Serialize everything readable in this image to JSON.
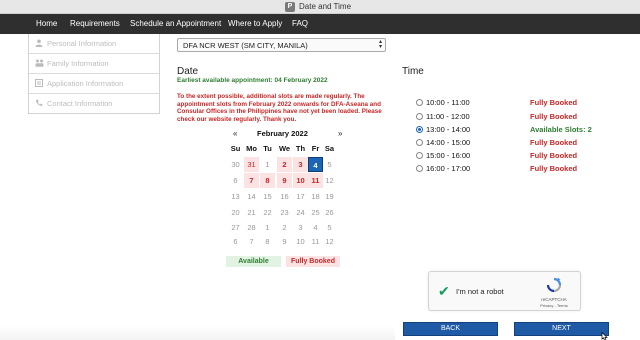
{
  "window": {
    "title": "Date and Time",
    "app_icon_letter": "P"
  },
  "nav": {
    "items": [
      {
        "label": "Home"
      },
      {
        "label": "Requirements"
      },
      {
        "label": "Schedule an Appointment"
      },
      {
        "label": "Where to Apply"
      },
      {
        "label": "FAQ"
      }
    ]
  },
  "sidebar": {
    "items": [
      {
        "label": "Personal Information",
        "icon": "user-icon"
      },
      {
        "label": "Family Information",
        "icon": "family-icon"
      },
      {
        "label": "Application Information",
        "icon": "list-icon"
      },
      {
        "label": "Contact Information",
        "icon": "phone-icon"
      }
    ]
  },
  "site_select": {
    "value": "DFA NCR WEST (SM CITY, MANILA)"
  },
  "date_section": {
    "heading": "Date",
    "earliest": "Earliest available appointment: 04 February 2022",
    "notice": "To the extent possible, additional slots are made regularly. The appointment slots from February 2022 onwards for DFA-Aseana and Consular Offices in the Philippines have not yet been loaded. Please check our website regularly. Thank you."
  },
  "calendar": {
    "prev": "«",
    "next": "»",
    "month_label": "February 2022",
    "weekdays": [
      "Su",
      "Mo",
      "Tu",
      "We",
      "Th",
      "Fr",
      "Sa"
    ],
    "weeks": [
      [
        "30",
        "31",
        "1",
        "2",
        "3",
        "4",
        "5"
      ],
      [
        "6",
        "7",
        "8",
        "9",
        "10",
        "11",
        "12"
      ],
      [
        "13",
        "14",
        "15",
        "16",
        "17",
        "18",
        "19"
      ],
      [
        "20",
        "21",
        "22",
        "23",
        "24",
        "25",
        "26"
      ],
      [
        "27",
        "28",
        "1",
        "2",
        "3",
        "4",
        "5"
      ],
      [
        "6",
        "7",
        "8",
        "9",
        "10",
        "11",
        "12"
      ]
    ],
    "legend_available": "Available",
    "legend_booked": "Fully Booked"
  },
  "time_section": {
    "heading": "Time",
    "slots": [
      {
        "time": "10:00 - 11:00",
        "status": "Fully Booked",
        "selected": false
      },
      {
        "time": "11:00 - 12:00",
        "status": "Fully Booked",
        "selected": false
      },
      {
        "time": "13:00 - 14:00",
        "status": "Available Slots: 2",
        "selected": true
      },
      {
        "time": "14:00 - 15:00",
        "status": "Fully Booked",
        "selected": false
      },
      {
        "time": "15:00 - 16:00",
        "status": "Fully Booked",
        "selected": false
      },
      {
        "time": "16:00 - 17:00",
        "status": "Fully Booked",
        "selected": false
      }
    ]
  },
  "recaptcha": {
    "label": "I'm not a robot",
    "brand": "reCAPTCHA",
    "links": "Privacy - Terms"
  },
  "buttons": {
    "back": "BACK",
    "next": "NEXT"
  },
  "colors": {
    "available": "#2e7d32",
    "booked": "#c62828",
    "selected_day": "#1e64b4",
    "button": "#1f5aa6",
    "navbar": "#2f2f2f"
  }
}
